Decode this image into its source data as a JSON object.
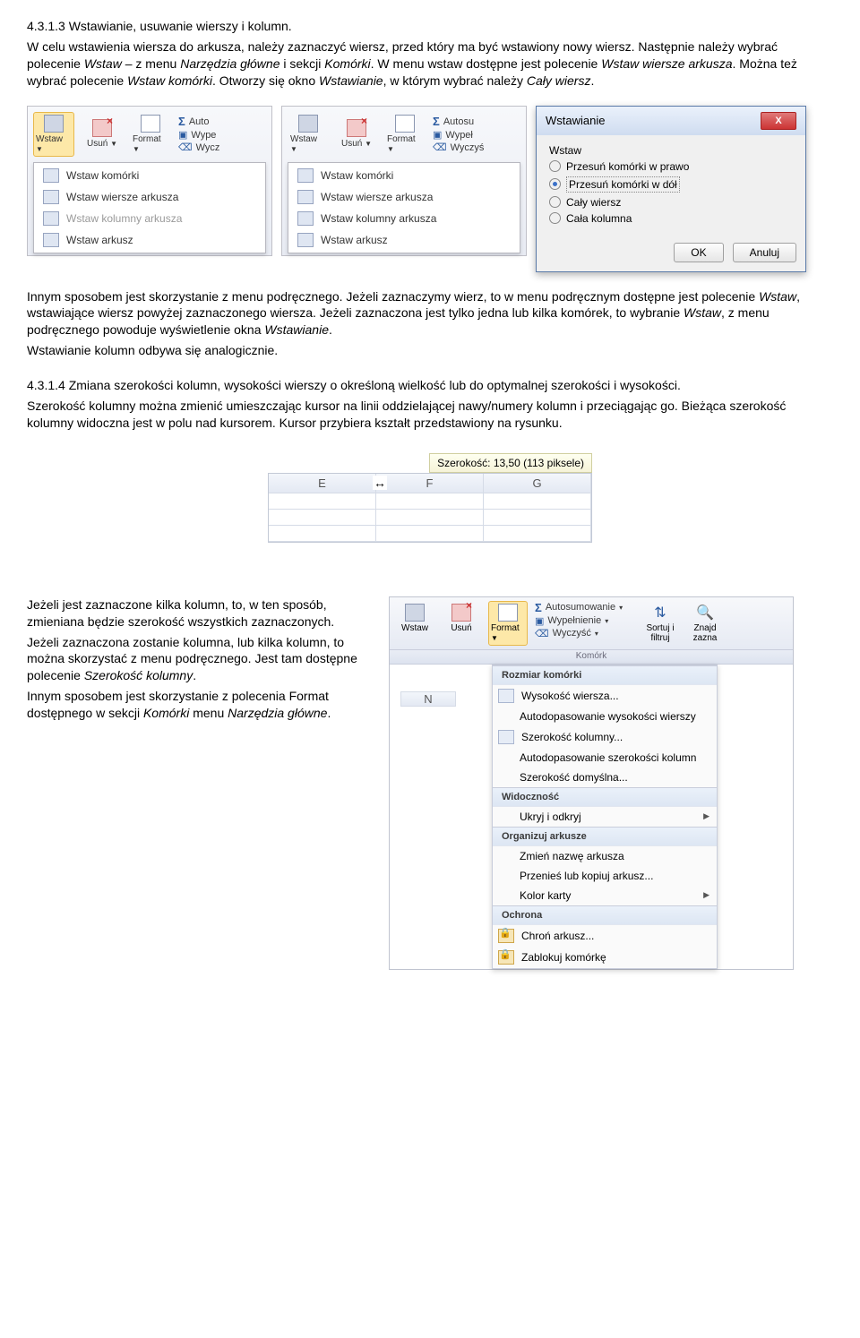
{
  "section1": {
    "heading": "4.3.1.3 Wstawianie, usuwanie wierszy i kolumn.",
    "p1a": "W celu wstawienia wiersza do arkusza, należy zaznaczyć wiersz, przed który ma być wstawiony nowy wiersz. Następnie należy wybrać polecenie ",
    "p1b": "Wstaw",
    "p1c": " – z menu ",
    "p1d": "Narzędzia główne",
    "p1e": " i sekcji ",
    "p1f": "Komórki",
    "p1g": ". W menu wstaw dostępne jest polecenie ",
    "p1h": "Wstaw wiersze arkusza",
    "p1i": ". Można też wybrać polecenie ",
    "p1j": "Wstaw komórki",
    "p1k": ". Otworzy się okno ",
    "p1l": "Wstawianie",
    "p1m": ", w którym wybrać należy ",
    "p1n": "Cały wiersz",
    "p1o": "."
  },
  "ribbon": {
    "wstaw": "Wstaw",
    "usun": "Usuń",
    "format": "Format",
    "autosum": "Auto",
    "autosum2": "Autosu",
    "wype": "Wype",
    "wypel": "Wypeł",
    "wycz": "Wycz",
    "wyczys": "Wyczyś",
    "dd1": "Wstaw komórki",
    "dd2": "Wstaw wiersze arkusza",
    "dd3": "Wstaw kolumny arkusza",
    "dd4": "Wstaw arkusz"
  },
  "dialog": {
    "title": "Wstawianie",
    "grp": "Wstaw",
    "opt1": "Przesuń komórki w prawo",
    "opt2": "Przesuń komórki w dół",
    "opt3": "Cały wiersz",
    "opt4": "Cała kolumna",
    "ok": "OK",
    "cancel": "Anuluj"
  },
  "section2": {
    "p1a": "Innym sposobem jest skorzystanie z menu podręcznego. Jeżeli zaznaczymy wierz, to w menu podręcznym dostępne jest polecenie ",
    "p1b": "Wstaw",
    "p1c": ", wstawiające wiersz powyżej zaznaczonego wiersza. Jeżeli zaznaczona jest tylko jedna lub kilka komórek, to wybranie ",
    "p1d": "Wstaw",
    "p1e": ", z menu podręcznego powoduje wyświetlenie okna ",
    "p1f": "Wstawianie",
    "p1g": ".",
    "p2": "Wstawianie kolumn odbywa się analogicznie.",
    "h2": "4.3.1.4 Zmiana szerokości kolumn, wysokości wierszy o określoną wielkość lub do optymalnej szerokości i wysokości.",
    "p3": "Szerokość kolumny można zmienić umieszczając kursor na linii oddzielającej nawy/numery kolumn i przeciągając go. Bieżąca szerokość kolumny widoczna jest w polu nad kursorem. Kursor przybiera kształt przedstawiony na rysunku."
  },
  "tooltip": "Szerokość: 13,50 (113 piksele)",
  "cols": {
    "E": "E",
    "F": "F",
    "G": "G"
  },
  "section3": {
    "p1": "Jeżeli jest zaznaczone kilka kolumn, to, w ten sposób, zmieniana będzie szerokość wszystkich zaznaczonych.",
    "p2a": "Jeżeli zaznaczona zostanie kolumna, lub kilka kolumn, to można skorzystać z menu podręcznego. Jest tam dostępne polecenie ",
    "p2b": "Szerokość kolumny",
    "p2c": ".",
    "p3a": "Innym sposobem jest skorzystanie z polecenia Format dostępnego w sekcji ",
    "p3b": "Komórki",
    "p3c": " menu ",
    "p3d": "Narzędzia główne",
    "p3e": "."
  },
  "ctx": {
    "autosumo": "Autosumowanie",
    "wypeln": "Wypełnienie",
    "wyczysc": "Wyczyść",
    "sortuj": "Sortuj i",
    "filtruj": "filtruj",
    "znajdz": "Znajd",
    "zazna": "zazna",
    "komorki": "Komórk",
    "N": "N",
    "hdr1": "Rozmiar komórki",
    "i1": "Wysokość wiersza...",
    "i2": "Autodopasowanie wysokości wierszy",
    "i3": "Szerokość kolumny...",
    "i4": "Autodopasowanie szerokości kolumn",
    "i5": "Szerokość domyślna...",
    "hdr2": "Widoczność",
    "i6": "Ukryj i odkryj",
    "hdr3": "Organizuj arkusze",
    "i7": "Zmień nazwę arkusza",
    "i8": "Przenieś lub kopiuj arkusz...",
    "i9": "Kolor karty",
    "hdr4": "Ochrona",
    "i10": "Chroń arkusz...",
    "i11": "Zablokuj komórkę"
  }
}
